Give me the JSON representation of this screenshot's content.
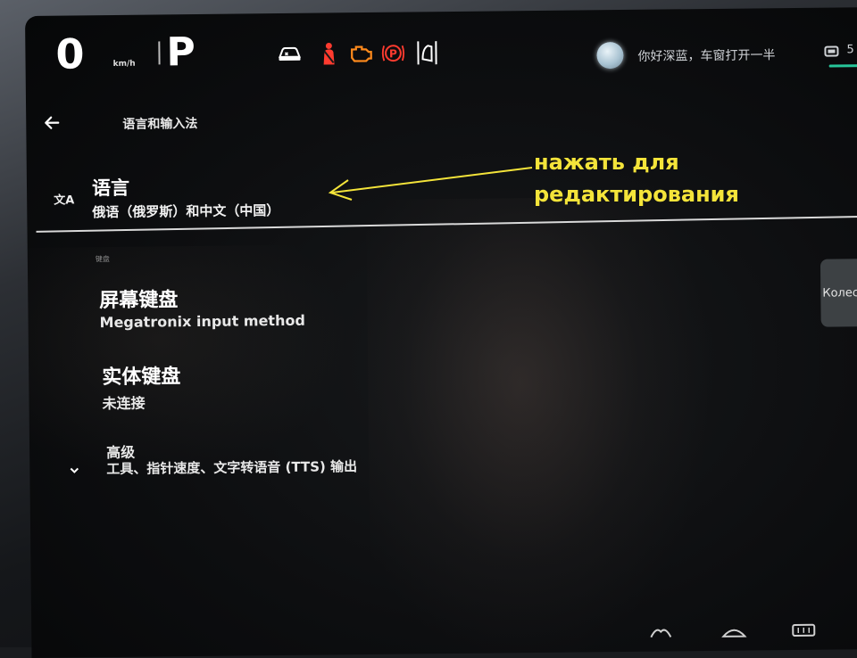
{
  "status": {
    "speed": "0",
    "speed_unit": "km/h",
    "gear": "P",
    "greeting": "你好深蓝，车窗打开一半",
    "status_right_value": "5"
  },
  "icons": [
    "car-warning-icon",
    "seatbelt-icon",
    "engine-check-icon",
    "parking-brake-icon",
    "door-open-icon"
  ],
  "colors": {
    "warning_red": "#ff3b2f",
    "warning_orange": "#ff8a1c",
    "annotation_yellow": "#f4e43a",
    "accent_green": "#27c59a"
  },
  "header": {
    "title": "语言和输入法"
  },
  "language": {
    "title": "语言",
    "value": "俄语（俄罗斯）和中文（中国）",
    "icon_label": "文A"
  },
  "keyboard": {
    "section_label": "键盘",
    "screen_keyboard": {
      "title": "屏幕键盘",
      "subtitle": "Megatronix input method"
    },
    "physical_keyboard": {
      "title": "实体键盘",
      "subtitle": "未连接"
    },
    "advanced": {
      "title": "高级",
      "subtitle": "工具、指针速度、文字转语音 (TTS) 输出"
    }
  },
  "side_button": {
    "label": "Колеса"
  },
  "annotation": {
    "line1": "нажать для",
    "line2": "редактирования"
  }
}
